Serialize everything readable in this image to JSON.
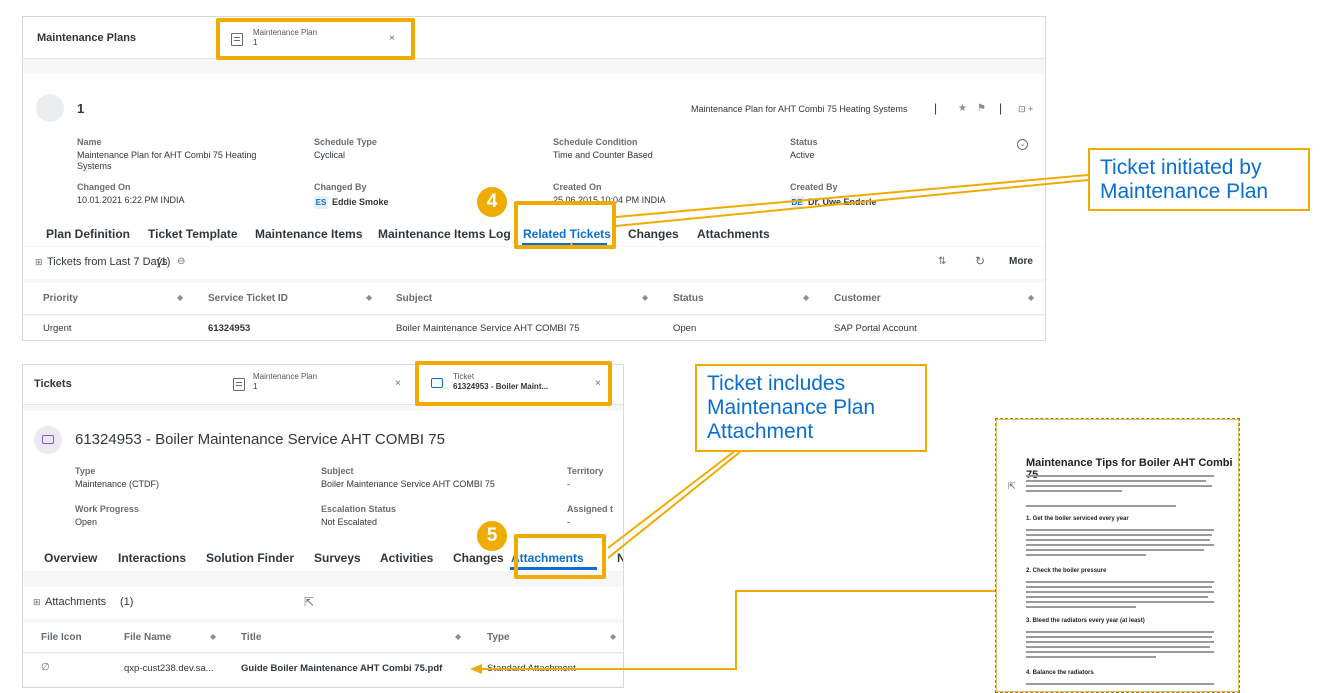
{
  "panel1": {
    "tabs": {
      "root": "Maintenance Plans",
      "obj_type": "Maintenance Plan",
      "obj_id": "1",
      "close": "×"
    },
    "header": {
      "id": "1",
      "title": "Maintenance Plan for AHT Combi 75 Heating Systems",
      "actions": {
        "star": "★",
        "flag": "⚑",
        "sep": "|",
        "expand": "⊡ +"
      }
    },
    "fields": {
      "name_label": "Name",
      "name_value": "Maintenance Plan for AHT Combi 75 Heating Systems",
      "schedule_type_label": "Schedule Type",
      "schedule_type_value": "Cyclical",
      "schedule_condition_label": "Schedule Condition",
      "schedule_condition_value": "Time and Counter Based",
      "status_label": "Status",
      "status_value": "Active",
      "changed_on_label": "Changed On",
      "changed_on_value": "10.01.2021 6:22 PM INDIA",
      "changed_by_label": "Changed By",
      "changed_by_initials": "ES",
      "changed_by_value": "Eddie Smoke",
      "created_on_label": "Created On",
      "created_on_value": "25.06.2015 10:04 PM INDIA",
      "created_by_label": "Created By",
      "created_by_initials": "DE",
      "created_by_value": "Dr. Uwe Enderle"
    },
    "nav_tabs": [
      "Plan Definition",
      "Ticket Template",
      "Maintenance Items",
      "Maintenance Items Log",
      "Related Tickets",
      "Changes",
      "Attachments"
    ],
    "step_badge": "4",
    "section": {
      "title": "Tickets from Last 7 Days",
      "count": "(1)",
      "more": "More"
    },
    "table": {
      "headers": [
        "Priority",
        "Service Ticket ID",
        "Subject",
        "Status",
        "Customer"
      ],
      "row": [
        "Urgent",
        "61324953",
        "Boiler Maintenance Service AHT COMBI 75",
        "Open",
        "SAP Portal Account"
      ]
    }
  },
  "panel2": {
    "tabs": {
      "root": "Tickets",
      "mp_type": "Maintenance Plan",
      "mp_id": "1",
      "ticket_type": "Ticket",
      "ticket_id": "61324953 - Boiler Maint...",
      "close": "×"
    },
    "header": {
      "title": "61324953 - Boiler Maintenance Service AHT COMBI 75"
    },
    "fields": {
      "type_label": "Type",
      "type_value": "Maintenance (CTDF)",
      "subject_label": "Subject",
      "subject_value": "Boiler Maintenance Service AHT COMBI 75",
      "territory_label": "Territory",
      "territory_value": "-",
      "work_progress_label": "Work Progress",
      "work_progress_value": "Open",
      "escalation_label": "Escalation Status",
      "escalation_value": "Not Escalated",
      "assigned_label": "Assigned t",
      "assigned_value": "-"
    },
    "nav_tabs": [
      "Overview",
      "Interactions",
      "Solution Finder",
      "Surveys",
      "Activities",
      "Changes",
      "Attachments",
      "N"
    ],
    "step_badge": "5",
    "section": {
      "title": "Attachments",
      "count": "(1)"
    },
    "table": {
      "headers": [
        "File Icon",
        "File Name",
        "Title",
        "Type"
      ],
      "row": [
        "qxp-cust238.dev.sa...",
        "Guide Boiler Maintenance AHT Combi 75.pdf",
        "Standard Attachment"
      ]
    }
  },
  "callouts": {
    "c1_line1": "Ticket initiated by",
    "c1_line2": "Maintenance Plan",
    "c2_line1": "Ticket includes",
    "c2_line2": "Maintenance Plan",
    "c2_line3": "Attachment"
  },
  "document": {
    "title": "Maintenance Tips for Boiler AHT Combi 75",
    "headings": [
      "1. Get the boiler serviced every year",
      "2. Check the boiler pressure",
      "3. Bleed the radiators every year (at least)",
      "4. Balance the radiators"
    ]
  },
  "colors": {
    "accent": "#f0ab00",
    "link": "#0a6ed1"
  }
}
